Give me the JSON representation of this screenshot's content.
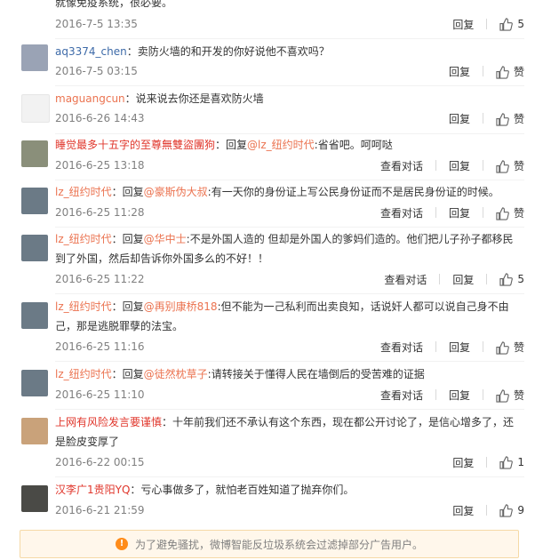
{
  "comments": [
    {
      "text_tail": "就像免疫系统，很必要。",
      "time": "2016-7-5 13:35",
      "reply": "回复",
      "like": "5"
    },
    {
      "user": "aq3374_chen",
      "text": "：卖防火墙的和开发的你好说他不喜欢吗？",
      "time": "2016-7-5 03:15",
      "reply": "回复",
      "like": "赞"
    },
    {
      "user": "maguangcun",
      "text": "：说来说去你还是喜欢防火墙",
      "time": "2016-6-26 14:43",
      "reply": "回复",
      "like": "赞"
    },
    {
      "user": "睡觉最多十五字的至尊無雙盜團狗",
      "pre": "：回复",
      "mention": "@lz_纽约时代",
      "text": ":省省吧。呵呵哒",
      "time": "2016-6-25 13:18",
      "view": "查看对话",
      "reply": "回复",
      "like": "赞"
    },
    {
      "user": "lz_纽约时代",
      "pre": "：回复",
      "mention": "@豪斯伪大叔",
      "text": ":有一天你的身份证上写公民身份证而不是居民身份证的时候。",
      "time": "2016-6-25 11:28",
      "view": "查看对话",
      "reply": "回复",
      "like": "赞"
    },
    {
      "user": "lz_纽约时代",
      "pre": "：回复",
      "mention": "@华中士",
      "text": ":不是外国人造的  但却是外国人的爹妈们造的。他们把儿子孙子都移民到了外国，然后却告诉你外国多么的不好！！",
      "time": "2016-6-25 11:22",
      "view": "查看对话",
      "reply": "回复",
      "like": "5"
    },
    {
      "user": "lz_纽约时代",
      "pre": "：回复",
      "mention": "@再别康桥818",
      "text": ":但不能为一己私利而出卖良知，话说奸人都可以说自己身不由己，那是逃脱罪孽的法宝。",
      "time": "2016-6-25 11:16",
      "view": "查看对话",
      "reply": "回复",
      "like": "赞"
    },
    {
      "user": "lz_纽约时代",
      "pre": "：回复",
      "mention": "@徒然枕草子",
      "text": ":请转接关于懂得人民在墙倒后的受苦难的证据",
      "time": "2016-6-25 11:10",
      "view": "查看对话",
      "reply": "回复",
      "like": "赞"
    },
    {
      "user": "上网有风险发言要谨慎",
      "text": "：十年前我们还不承认有这个东西，现在都公开讨论了，是信心增多了，还是脸皮变厚了",
      "time": "2016-6-22 00:15",
      "reply": "回复",
      "like": "1"
    },
    {
      "user": "汉李广1贵阳YQ",
      "text": "：亏心事做多了，就怕老百姓知道了抛弃你们。",
      "time": "2016-6-21 21:59",
      "reply": "回复",
      "like": "9"
    }
  ],
  "notice": "为了避免骚扰，微博智能反垃圾系统会过滤掉部分广告用户。",
  "colors": {
    "username": "#eb7350",
    "accent": "#ff8c1a"
  }
}
